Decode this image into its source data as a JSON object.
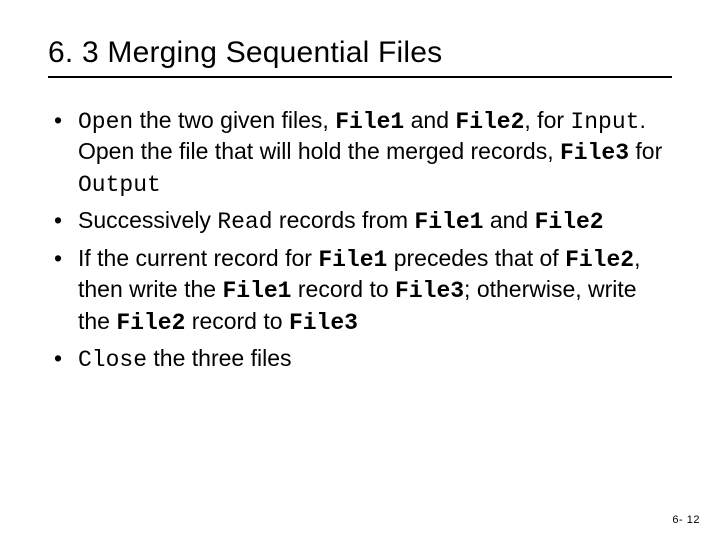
{
  "title": "6. 3 Merging Sequential Files",
  "bullets": {
    "b1": {
      "t1": "Open",
      "t2": " the two given files, ",
      "t3": "File1",
      "t4": " and ",
      "t5": "File2",
      "t6": ", for ",
      "t7": "Input",
      "t8": ". Open the file that will hold the merged records, ",
      "t9": "File3",
      "t10": " for ",
      "t11": "Output"
    },
    "b2": {
      "t1": "Successively ",
      "t2": "Read",
      "t3": " records from ",
      "t4": "File1",
      "t5": " and ",
      "t6": "File2"
    },
    "b3": {
      "t1": "If the current record for ",
      "t2": "File1",
      "t3": " precedes that of ",
      "t4": "File2",
      "t5": ", then write the ",
      "t6": "File1",
      "t7": " record to ",
      "t8": "File3",
      "t9": "; otherwise, write the ",
      "t10": "File2",
      "t11": " record to ",
      "t12": "File3"
    },
    "b4": {
      "t1": "Close",
      "t2": " the three files"
    }
  },
  "footer": "6- 12"
}
